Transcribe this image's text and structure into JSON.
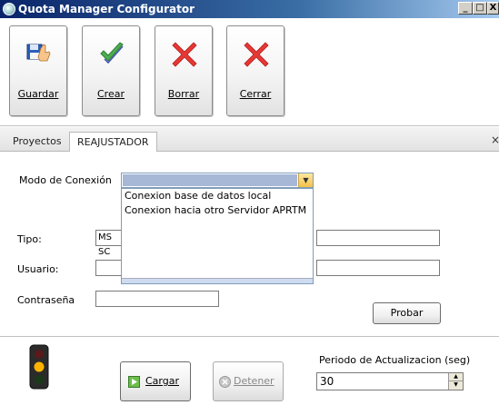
{
  "window": {
    "title": "Quota Manager Configurator",
    "min_glyph": "_",
    "max_glyph": "□",
    "close_glyph": "X"
  },
  "toolbar": {
    "guardar_label": "Guardar",
    "crear_label": "Crear",
    "borrar_label": "Borrar",
    "cerrar_label": "Cerrar"
  },
  "tabs": {
    "items": [
      {
        "label": "Proyectos"
      },
      {
        "label": "REAJUSTADOR"
      }
    ],
    "close_glyph": "×"
  },
  "form": {
    "modo_label": "Modo de Conexión",
    "modo_options": [
      "Conexion base de datos local",
      "Conexion hacia otro Servidor APRTM"
    ],
    "tipo_label": "Tipo:",
    "tipo_value": "MS SC",
    "usuario_label": "Usuario:",
    "contrasena_label": "Contraseña",
    "probar_label": "Probar"
  },
  "bottom": {
    "cargar_label": "Cargar",
    "detener_label": "Detener",
    "periodo_label": "Periodo de Actualizacion  (seg)",
    "periodo_value": "30"
  },
  "colors": {
    "title_start": "#0a246a",
    "title_end": "#a6caf0",
    "combo_highlight": "#a7b8d6",
    "delete_red": "#e53935",
    "check_green": "#4caf50"
  }
}
